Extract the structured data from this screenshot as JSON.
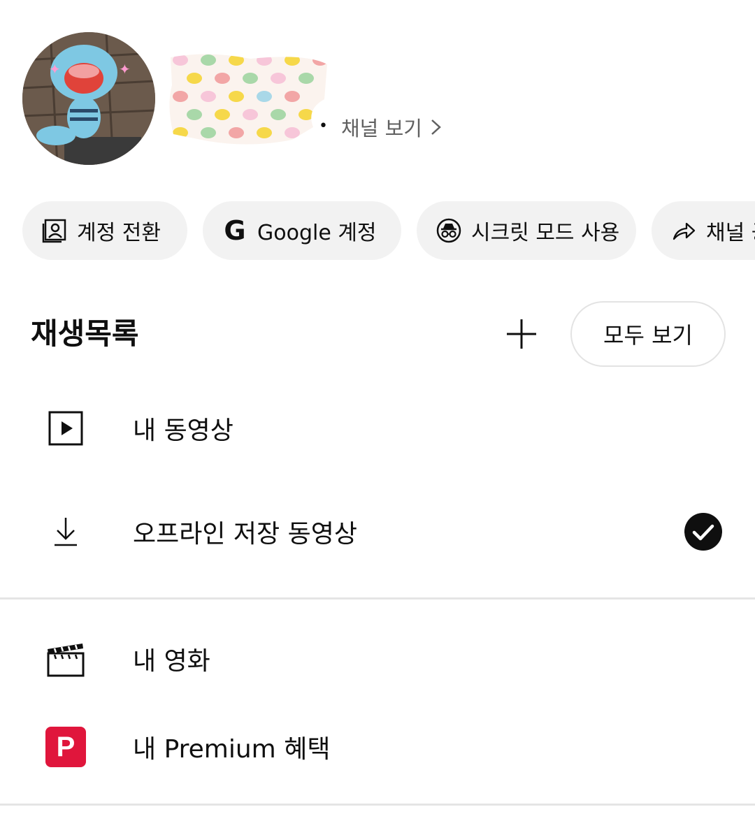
{
  "profile": {
    "channel_link_label": "채널 보기"
  },
  "chips": [
    {
      "label": "계정 전환",
      "icon": "account-switch-icon"
    },
    {
      "label": "Google 계정",
      "icon": "google-g-icon"
    },
    {
      "label": "시크릿 모드 사용",
      "icon": "incognito-icon"
    },
    {
      "label": "채널 공유",
      "icon": "share-icon"
    }
  ],
  "playlist_section": {
    "title": "재생목록",
    "view_all_label": "모두 보기"
  },
  "menu": {
    "my_videos": "내 동영상",
    "offline_videos": "오프라인 저장 동영상",
    "my_movies": "내 영화",
    "premium_benefits": "내 Premium 혜택",
    "premium_icon_letter": "P"
  },
  "colors": {
    "premium_red": "#e0163c",
    "chip_bg": "#f2f2f2",
    "secondary_text": "#606060"
  }
}
